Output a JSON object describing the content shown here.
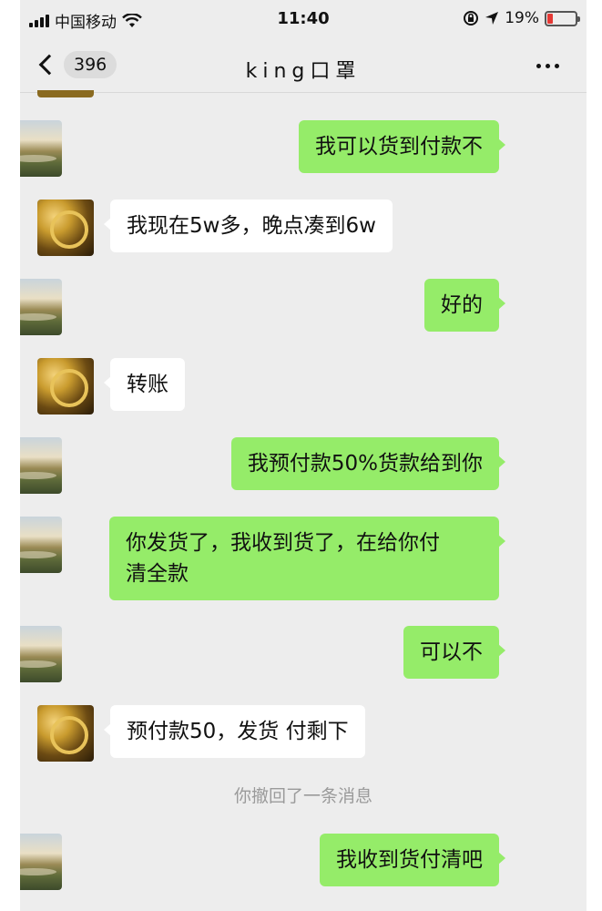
{
  "status_bar": {
    "carrier": "中国移动",
    "time": "11:40",
    "battery": "19%",
    "battery_level": 0.19
  },
  "nav": {
    "back_badge": "396",
    "title": "king口罩"
  },
  "messages": [
    {
      "side": "right",
      "text": "我可以货到付款不"
    },
    {
      "side": "left",
      "text": "我现在5w多，晚点凑到6w"
    },
    {
      "side": "right",
      "text": "好的"
    },
    {
      "side": "left",
      "text": "转账"
    },
    {
      "side": "right",
      "text": "我预付款50%货款给到你"
    },
    {
      "side": "right",
      "text_line1": "你发货了，我收到货了，在给你付",
      "text_line2": "清全款"
    },
    {
      "side": "right",
      "text": "可以不"
    },
    {
      "side": "left",
      "text": "预付款50，发货 付剩下"
    },
    {
      "side": "system",
      "text": "你撤回了一条消息"
    },
    {
      "side": "right",
      "text": "我收到货付清吧"
    }
  ]
}
